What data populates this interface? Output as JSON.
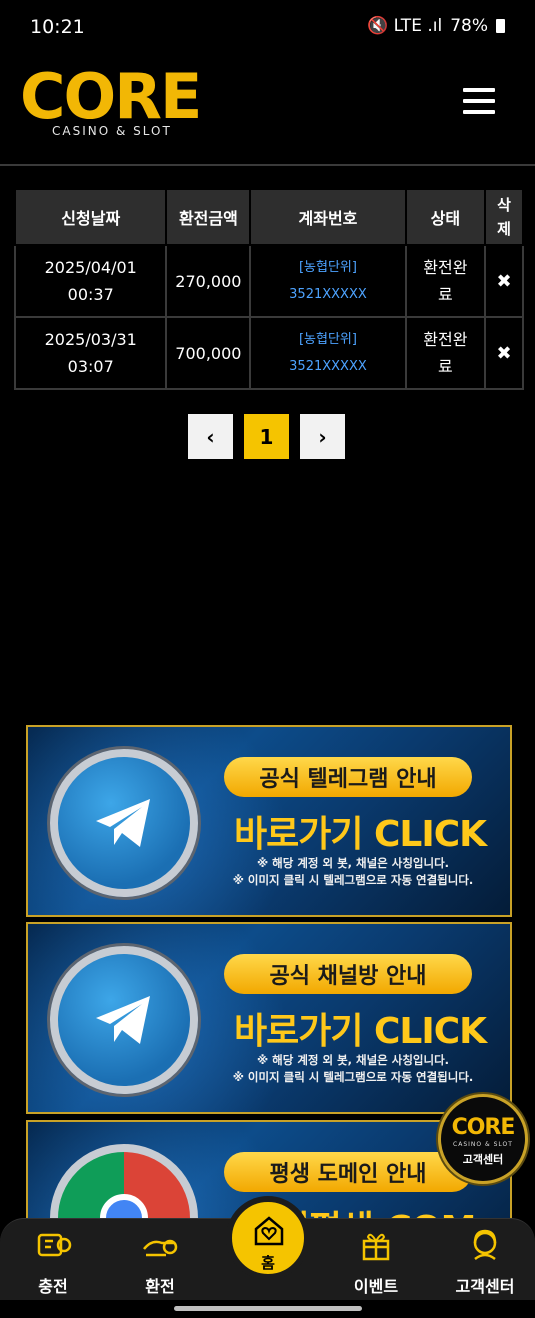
{
  "status_bar": {
    "time": "10:21",
    "indicators": "🔇 LTE .ıl",
    "battery": "78%"
  },
  "header": {
    "logo_text": "CORE",
    "logo_sub": "CASINO & SLOT",
    "menu_icon": "hamburger-icon"
  },
  "table": {
    "headers": [
      "신청날짜",
      "환전금액",
      "계좌번호",
      "상태",
      "삭제"
    ],
    "rows": [
      {
        "date": "2025/04/01",
        "time": "00:37",
        "amount": "270,000",
        "bank": "[농협단위]",
        "account": "3521XXXXX",
        "status_line1": "환전완",
        "status_line2": "료",
        "delete_icon": "✖"
      },
      {
        "date": "2025/03/31",
        "time": "03:07",
        "amount": "700,000",
        "bank": "[농협단위]",
        "account": "3521XXXXX",
        "status_line1": "환전완",
        "status_line2": "료",
        "delete_icon": "✖"
      }
    ]
  },
  "pagination": {
    "prev": "‹",
    "current": "1",
    "next": "›"
  },
  "banners": [
    {
      "pill": "공식 텔레그램 안내",
      "headline": "바로가기 CLICK",
      "note1": "※ 해당 계정 외 봇, 채널은 사칭입니다.",
      "note2": "※ 이미지 클릭 시 텔레그램으로 자동 연결됩니다."
    },
    {
      "pill": "공식 채널방 안내",
      "headline": "바로가기 CLICK",
      "note1": "※ 해당 계정 외 봇, 채널은 사칭입니다.",
      "note2": "※ 이미지 클릭 시 텔레그램으로 자동 연결됩니다."
    },
    {
      "pill": "평생 도메인 안내",
      "headline": "코어평생.COM"
    }
  ],
  "support_badge": {
    "logo": "CORE",
    "sub": "CASINO & SLOT",
    "label": "고객센터"
  },
  "bottom_nav": {
    "deposit": "충전",
    "withdraw": "환전",
    "home": "홈",
    "event": "이벤트",
    "support": "고객센터"
  },
  "colors": {
    "accent": "#f5c400",
    "link": "#4da3ff",
    "banner_border": "#c9a227"
  }
}
